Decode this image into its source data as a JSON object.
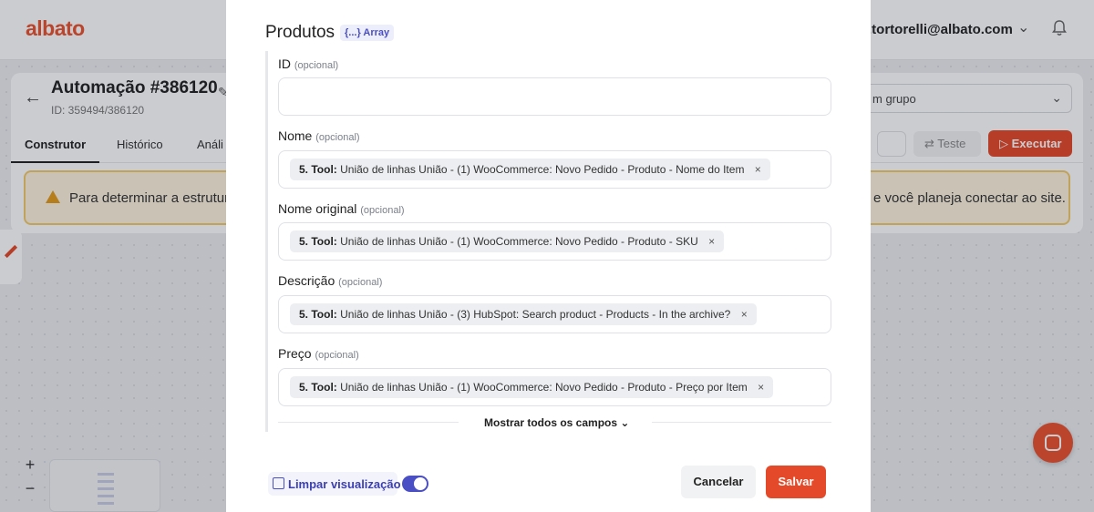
{
  "app": {
    "logo_text": "albato",
    "user_email": ".tortorelli@albato.com",
    "automation_title": "Automação #386120",
    "automation_id": "ID: 359494/386120",
    "tabs": [
      {
        "label": "Construtor",
        "active": true
      },
      {
        "label": "Histórico",
        "active": false
      },
      {
        "label": "Análi",
        "active": false
      }
    ],
    "group_select_value": "m grupo",
    "test_label": "Teste",
    "execute_label": "Executar",
    "warning_left": "Para determinar a estrutura",
    "warning_right": "e você planeja conectar ao site.",
    "zoom_in": "+",
    "zoom_out": "−",
    "accent_color": "#e9512f"
  },
  "modal": {
    "section_title": "Produtos",
    "array_badge": "{...} Array",
    "fields": [
      {
        "label": "ID",
        "optional": "(opcional)",
        "value": ""
      },
      {
        "label": "Nome",
        "optional": "(opcional)",
        "chip_prefix": "5. Tool:",
        "chip_text": "União de linhas União - (1) WooCommerce: Novo Pedido - Produto - Nome do Item"
      },
      {
        "label": "Nome original",
        "optional": "(opcional)",
        "chip_prefix": "5. Tool:",
        "chip_text": "União de linhas União - (1) WooCommerce: Novo Pedido - Produto - SKU"
      },
      {
        "label": "Descrição",
        "optional": "(opcional)",
        "chip_prefix": "5. Tool:",
        "chip_text": "União de linhas União - (3) HubSpot: Search product - Products - In the archive?"
      },
      {
        "label": "Preço",
        "optional": "(opcional)",
        "chip_prefix": "5. Tool:",
        "chip_text": "União de linhas União - (1) WooCommerce: Novo Pedido - Produto - Preço por Item"
      }
    ],
    "chip_remove": "×",
    "show_all_fields": "Mostrar todos os campos",
    "show_all_chevron": "⌄",
    "clear_preview_label": "Limpar visualização",
    "clear_preview_on": true,
    "cancel_label": "Cancelar",
    "save_label": "Salvar"
  }
}
